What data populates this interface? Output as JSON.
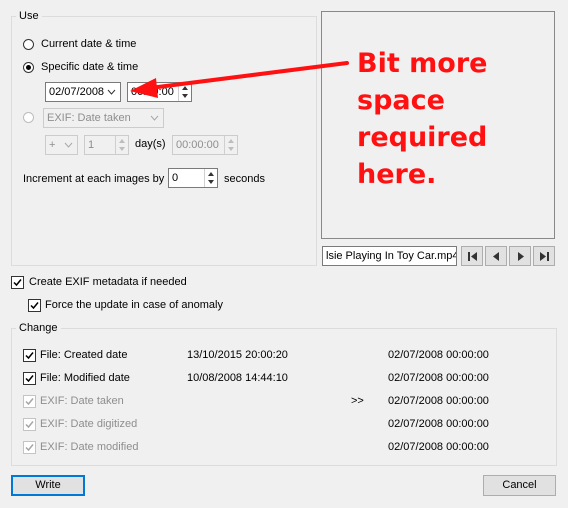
{
  "use_group": {
    "title": "Use",
    "option_current": "Current date & time",
    "option_specific": "Specific date & time",
    "date_value": "02/07/2008",
    "time_value": "00:00:00",
    "option_exif": "EXIF: Date taken",
    "offset_sign": "+",
    "offset_value": "1",
    "offset_unit": "day(s)",
    "offset_time": "00:00:00",
    "increment_label": "Increment at each images by",
    "increment_value": "0",
    "increment_unit": "seconds"
  },
  "preview": {
    "filename": "lsie Playing In Toy Car.mp4"
  },
  "options": {
    "create_exif": "Create EXIF metadata if needed",
    "force_update": "Force the update in case of anomaly"
  },
  "change_group": {
    "title": "Change",
    "rows": [
      {
        "label": "File: Created date",
        "old": "13/10/2015 20:00:20",
        "arrow": "",
        "new": "02/07/2008 00:00:00",
        "checked": true,
        "enabled": true
      },
      {
        "label": "File: Modified date",
        "old": "10/08/2008 14:44:10",
        "arrow": "",
        "new": "02/07/2008 00:00:00",
        "checked": true,
        "enabled": true
      },
      {
        "label": "EXIF: Date taken",
        "old": "",
        "arrow": ">>",
        "new": "02/07/2008 00:00:00",
        "checked": true,
        "enabled": false
      },
      {
        "label": "EXIF: Date digitized",
        "old": "",
        "arrow": "",
        "new": "02/07/2008 00:00:00",
        "checked": true,
        "enabled": false
      },
      {
        "label": "EXIF: Date modified",
        "old": "",
        "arrow": "",
        "new": "02/07/2008 00:00:00",
        "checked": true,
        "enabled": false
      }
    ]
  },
  "buttons": {
    "write": "Write",
    "cancel": "Cancel"
  },
  "annotation": {
    "line1": "Bit more",
    "line2": "space",
    "line3": "required",
    "line4": "here."
  },
  "colors": {
    "annotation": "#ff1111",
    "focus_border": "#0078d7"
  }
}
